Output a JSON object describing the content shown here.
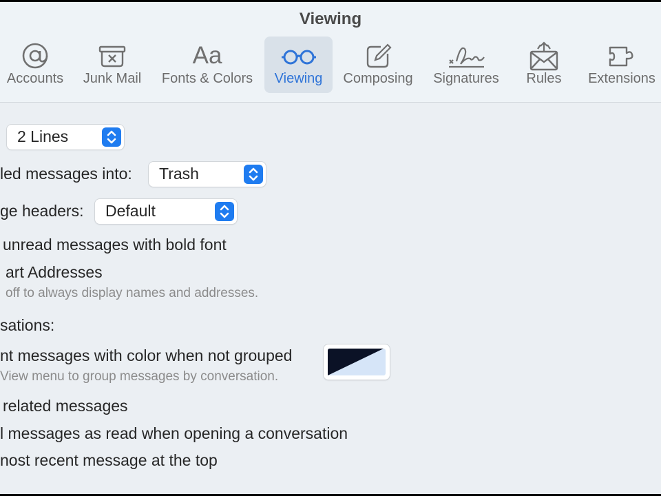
{
  "window": {
    "title": "Viewing"
  },
  "toolbar": {
    "tabs": [
      {
        "label": "Accounts",
        "icon": "at-icon"
      },
      {
        "label": "Junk Mail",
        "icon": "junk-mail-icon"
      },
      {
        "label": "Fonts & Colors",
        "icon": "fonts-icon",
        "glyph": "Aa"
      },
      {
        "label": "Viewing",
        "icon": "glasses-icon",
        "active": true
      },
      {
        "label": "Composing",
        "icon": "compose-icon"
      },
      {
        "label": "Signatures",
        "icon": "signature-icon"
      },
      {
        "label": "Rules",
        "icon": "rules-icon"
      },
      {
        "label": "Extensions",
        "icon": "puzzle-icon"
      }
    ]
  },
  "settings": {
    "list_preview": {
      "value": "2 Lines"
    },
    "move_discarded": {
      "label": "led messages into:",
      "value": "Trash"
    },
    "message_headers": {
      "label": "ge headers:",
      "value": "Default"
    },
    "bold_unread": {
      "label": "unread messages with bold font"
    },
    "smart_addresses": {
      "label": "art Addresses",
      "note": "off to always display names and addresses."
    },
    "conversations_heading": "sations:",
    "highlight_color": {
      "label": "nt messages with color when not grouped",
      "note": "View menu to group messages by conversation.",
      "color_dark": "#0b1226",
      "color_light": "#d6e5f8"
    },
    "related_messages": {
      "label": "related messages"
    },
    "mark_read": {
      "label": "l messages as read when opening a conversation"
    },
    "recent_top": {
      "label": "nost recent message at the top"
    }
  },
  "colors": {
    "accent": "#2f74d8",
    "popup_stepper": "#1f7cf0"
  }
}
